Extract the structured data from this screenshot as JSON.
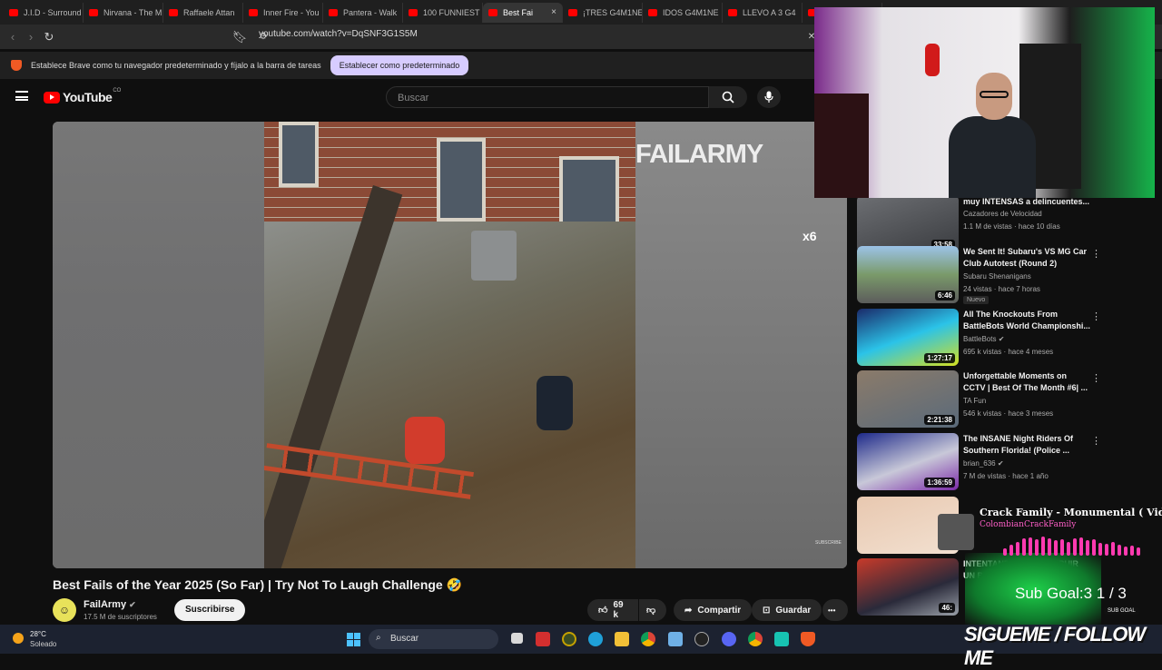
{
  "browser": {
    "tabs": [
      {
        "label": "J.I.D - Surround"
      },
      {
        "label": "Nirvana - The M"
      },
      {
        "label": "Raffaele Attan"
      },
      {
        "label": "Inner Fire - You"
      },
      {
        "label": "Pantera - Walk"
      },
      {
        "label": "100 FUNNIEST"
      },
      {
        "label": "Best Fai",
        "active": true
      },
      {
        "label": "¡TRES G4M1NE"
      },
      {
        "label": "IDOS G4M1NE"
      },
      {
        "label": "LLEVO A 3 G4"
      },
      {
        "label": ""
      }
    ],
    "url": "youtube.com/watch?v=DqSNF3G1S5M",
    "infobar_text": "Establece Brave como tu navegador predeterminado y fíjalo a la barra de tareas",
    "infobar_button": "Establecer como predeterminado"
  },
  "youtube": {
    "logo_text": "YouTube",
    "region": "CO",
    "search_placeholder": "Buscar"
  },
  "video": {
    "watermark": "FAILARMY",
    "multiplier": "x6",
    "subscribe_watermark": "SUBSCRIBE",
    "title": "Best Fails of the Year 2025 (So Far) | Try Not To Laugh Challenge 🤣",
    "channel": "FailArmy",
    "subscribers": "17.5 M de suscriptores",
    "subscribe_label": "Suscribirse",
    "likes": "69 k",
    "share_label": "Compartir",
    "save_label": "Guardar",
    "more_label": "•••"
  },
  "recommendations": [
    {
      "title": "muy INTENSAS a delincuentes...",
      "channel": "Cazadores de Velocidad",
      "meta": "1.1 M de vistas · hace 10 días",
      "duration": "33:58",
      "verified": false,
      "badge": ""
    },
    {
      "title": "We Sent It! Subaru's VS MG Car Club Autotest (Round 2)",
      "channel": "Subaru Shenanigans",
      "meta": "24 vistas · hace 7 horas",
      "duration": "6:46",
      "verified": false,
      "badge": "Nuevo"
    },
    {
      "title": "All The Knockouts From BattleBots World Championshi...",
      "channel": "BattleBots",
      "meta": "695 k vistas · hace 4 meses",
      "duration": "1:27:17",
      "verified": true,
      "badge": ""
    },
    {
      "title": "Unforgettable Moments on CCTV | Best Of The Month #6| ...",
      "channel": "TA Fun",
      "meta": "546 k vistas · hace 3 meses",
      "duration": "2:21:38",
      "verified": false,
      "badge": ""
    },
    {
      "title": "The INSANE Night Riders Of Southern Florida! (Police ...",
      "channel": "brian_636",
      "meta": "7 M de vistas · hace 1 año",
      "duration": "1:36:59",
      "verified": true,
      "badge": ""
    },
    {
      "title": "",
      "channel": "",
      "meta": "",
      "duration": "",
      "verified": false,
      "badge": ""
    },
    {
      "title": "INTENTANDO RECONSTRUIR UN BUGATTI CHIRON ...",
      "channel": "",
      "meta": "",
      "duration": "46:",
      "verified": false,
      "badge": ""
    }
  ],
  "overlay": {
    "music_title": "Crack Family - Monumental ( Video Of",
    "music_artist": "ColombianCrackFamily",
    "music_levels": [
      0.35,
      0.55,
      0.7,
      0.85,
      0.9,
      0.8,
      0.95,
      0.85,
      0.75,
      0.8,
      0.7,
      0.85,
      0.9,
      0.75,
      0.8,
      0.65,
      0.6,
      0.7,
      0.55,
      0.45,
      0.5,
      0.4
    ],
    "sub_goal": "Sub Goal:3  1 / 3",
    "sub_goal_badge": "SUB GOAL",
    "follow_text": "SIGUEME / FOLLOW ME"
  },
  "taskbar": {
    "temperature": "28°C",
    "condition": "Soleado",
    "search_label": "Buscar"
  }
}
